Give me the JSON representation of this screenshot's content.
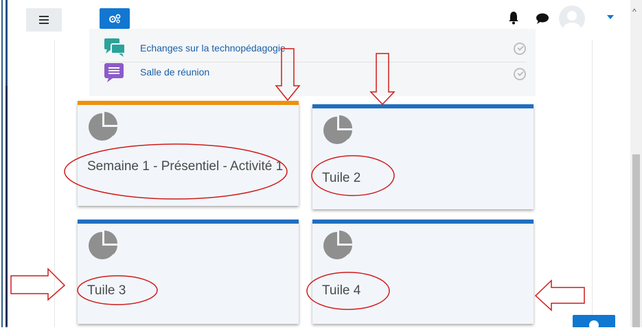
{
  "header": {
    "menu_icon": "hamburger-icon",
    "gear_icon": "cogs-icon",
    "notification_icon": "bell-icon",
    "messages_icon": "chat-bubble-icon",
    "user_icon": "avatar-placeholder"
  },
  "activities": [
    {
      "label": "Echanges sur la technopédagogie",
      "icon": "forum-icon",
      "icon_color": "#2aa39a"
    },
    {
      "label": "Salle de réunion",
      "icon": "chat-room-icon",
      "icon_color": "#8c5bc9"
    }
  ],
  "tiles": [
    {
      "title": "Semaine 1 - Présentiel - Activité 1",
      "icon": "pie-chart-icon",
      "accent": "#f0900a"
    },
    {
      "title": "Tuile 2",
      "icon": "pie-chart-icon",
      "accent": "#1f6fbf"
    },
    {
      "title": "Tuile 3",
      "icon": "pie-chart-icon",
      "accent": "#1f6fbf"
    },
    {
      "title": "Tuile 4",
      "icon": "pie-chart-icon",
      "accent": "#1f6fbf"
    }
  ],
  "colors": {
    "primary": "#1177d1",
    "annotation": "#d11a1a",
    "tile_bg": "#f2f6fb",
    "link": "#1a5fa8"
  }
}
